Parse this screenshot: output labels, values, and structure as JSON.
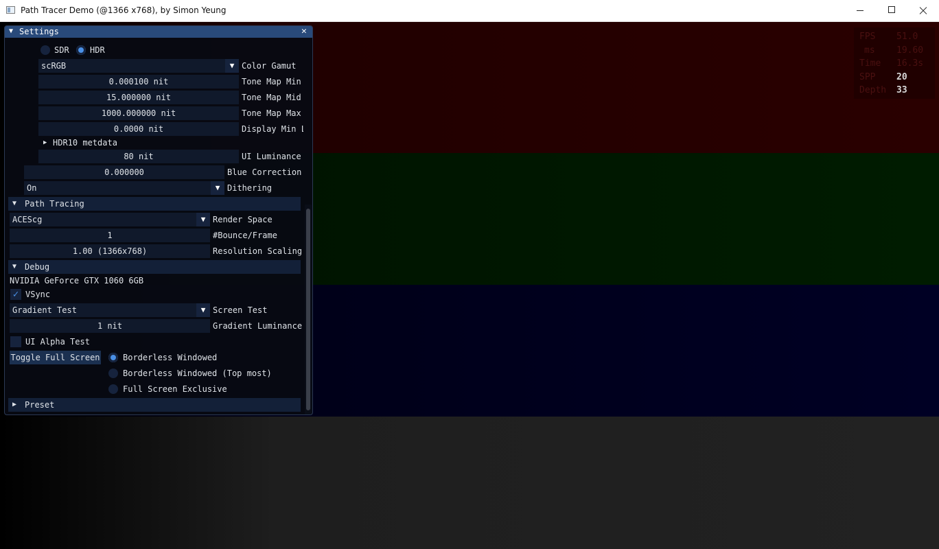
{
  "window": {
    "title": "Path Tracer Demo (@1366 x768), by Simon Yeung"
  },
  "stats": [
    {
      "label": "FPS",
      "value": "51.0"
    },
    {
      "label": "ms",
      "value": "19.60"
    },
    {
      "label": "Time",
      "value": "16.3s"
    },
    {
      "label": "SPP",
      "value": "20"
    },
    {
      "label": "Depth",
      "value": "33"
    }
  ],
  "settings": {
    "title": "Settings",
    "display_mode": {
      "sdr": "SDR",
      "hdr": "HDR",
      "selected": "HDR"
    },
    "color_gamut": {
      "value": "scRGB",
      "label": "Color Gamut"
    },
    "tone_map_min": {
      "value": "0.000100 nit",
      "label": "Tone Map Min"
    },
    "tone_map_mid": {
      "value": "15.000000 nit",
      "label": "Tone Map Mid"
    },
    "tone_map_max": {
      "value": "1000.000000 nit",
      "label": "Tone Map Max"
    },
    "display_min": {
      "value": "0.0000 nit",
      "label": "Display Min L"
    },
    "hdr10_metadata": "HDR10 metdata",
    "ui_luminance": {
      "value": "80 nit",
      "label": "UI Luminance"
    },
    "blue_correction": {
      "value": "0.000000",
      "label": "Blue Correction"
    },
    "dithering": {
      "value": "On",
      "label": "Dithering"
    },
    "path_tracing": {
      "header": "Path Tracing",
      "render_space": {
        "value": "ACEScg",
        "label": "Render Space"
      },
      "bounce": {
        "value": "1",
        "label": "#Bounce/Frame"
      },
      "resolution": {
        "value": "1.00 (1366x768)",
        "label": "Resolution Scaling"
      }
    },
    "debug": {
      "header": "Debug",
      "gpu": "NVIDIA GeForce GTX 1060 6GB",
      "vsync": {
        "label": "VSync",
        "checked": true
      },
      "screen_test": {
        "value": "Gradient Test",
        "label": "Screen Test"
      },
      "gradient_luminance": {
        "value": "1 nit",
        "label": "Gradient Luminance"
      },
      "ui_alpha_test": {
        "label": "UI Alpha Test",
        "checked": false
      },
      "toggle_full_screen": "Toggle Full Screen",
      "fullscreen_modes": [
        "Borderless Windowed",
        "Borderless Windowed (Top most)",
        "Full Screen Exclusive"
      ],
      "fullscreen_selected": "Borderless Windowed"
    },
    "preset": {
      "header": "Preset"
    }
  },
  "colors": {
    "accent": "#4a90e6",
    "title_bar": "#294a7a",
    "frame_bg": "#10192b"
  }
}
